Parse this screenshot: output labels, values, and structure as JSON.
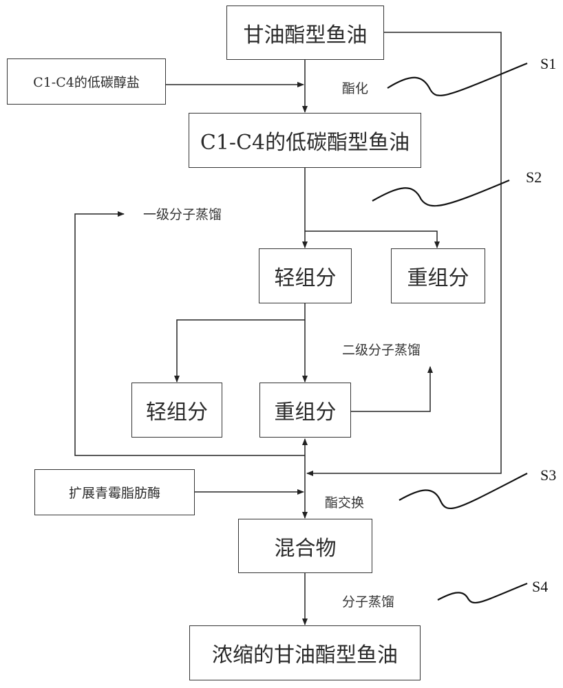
{
  "nodes": {
    "glyceride_fish_oil": "甘油酯型鱼油",
    "c1c4_alkoxide": "C1-C4的低碳醇盐",
    "c1c4_ester_fish_oil": "C1-C4的低碳酯型鱼油",
    "light_fraction_1": "轻组分",
    "heavy_fraction_1": "重组分",
    "light_fraction_2": "轻组分",
    "heavy_fraction_2": "重组分",
    "lipase": "扩展青霉脂肪酶",
    "mixture": "混合物",
    "concentrated_oil": "浓缩的甘油酯型鱼油"
  },
  "labels": {
    "esterification": "酯化",
    "primary_distillation": "一级分子蒸馏",
    "secondary_distillation": "二级分子蒸馏",
    "transesterification": "酯交换",
    "molecular_distillation": "分子蒸馏"
  },
  "steps": [
    "S1",
    "S2",
    "S3",
    "S4"
  ]
}
